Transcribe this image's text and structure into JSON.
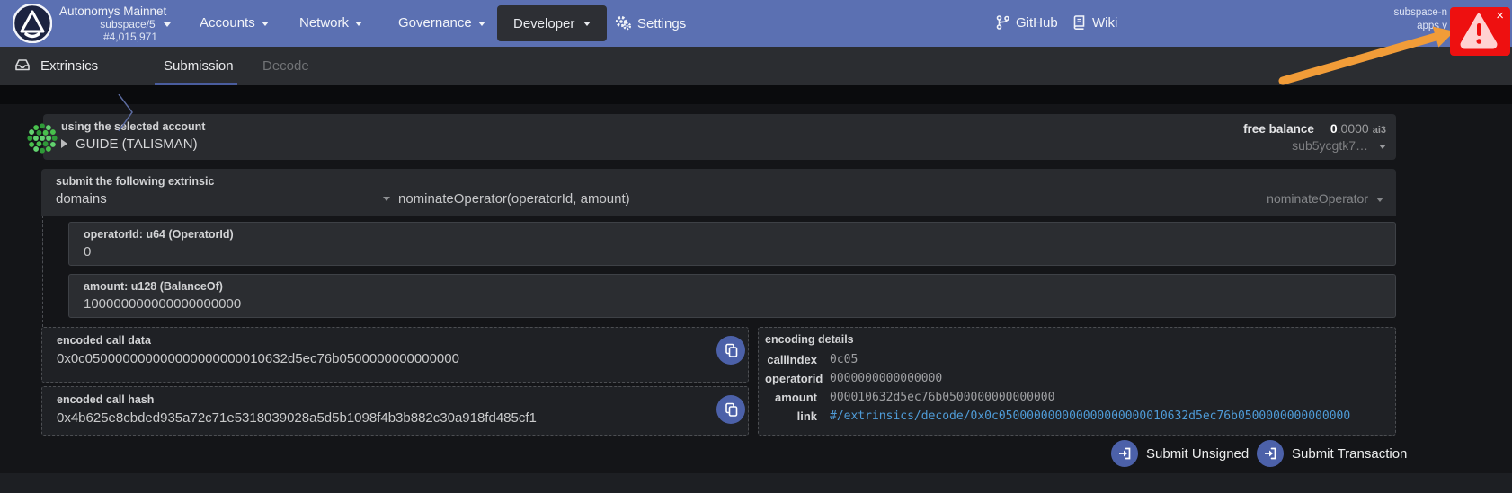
{
  "colors": {
    "nav_bg": "#5b70b2",
    "accent_blue": "#4c61a9",
    "link_blue": "#4f9cd8",
    "alert_red": "#ee1010",
    "arrow_orange": "#f19c38",
    "identicon_green": "#4ec24e",
    "tab_underline": "#4a5d9e"
  },
  "nav": {
    "chain": {
      "name": "Autonomys Mainnet",
      "runtime": "subspace/5",
      "block": "#4,015,971"
    },
    "items": [
      {
        "label": "Accounts"
      },
      {
        "label": "Network"
      },
      {
        "label": "Governance"
      },
      {
        "label": "Developer"
      },
      {
        "label": "Settings"
      }
    ],
    "links": [
      {
        "label": "GitHub"
      },
      {
        "label": "Wiki"
      }
    ],
    "corner_line1": "subspace-n",
    "corner_line2": "apps v",
    "alert_close": "×"
  },
  "tabbar": {
    "section": "Extrinsics",
    "tabs": [
      {
        "label": "Submission"
      },
      {
        "label": "Decode"
      }
    ]
  },
  "account": {
    "label": "using the selected account",
    "name": "GUIDE (TALISMAN)",
    "balance_label": "free balance",
    "balance_int": "0",
    "balance_frac": ".0000",
    "balance_unit": "ai3",
    "address": "sub5ycgtk7…"
  },
  "extrinsic": {
    "label": "submit the following extrinsic",
    "section": "domains",
    "signature": "nominateOperator(operatorId, amount)",
    "method": "nominateOperator"
  },
  "params": [
    {
      "label": "operatorId: u64 (OperatorId)",
      "value": "0"
    },
    {
      "label": "amount: u128 (BalanceOf)",
      "value": "100000000000000000000"
    }
  ],
  "output": {
    "call_data_label": "encoded call data",
    "call_data": "0x0c050000000000000000000010632d5ec76b0500000000000000",
    "call_hash_label": "encoded call hash",
    "call_hash": "0x4b625e8cbded935a72c71e5318039028a5d5b1098f4b3b882c30a918fd485cf1"
  },
  "encoding": {
    "title": "encoding details",
    "rows": [
      {
        "label": "callindex",
        "value": "0c05"
      },
      {
        "label": "operatorid",
        "value": "0000000000000000"
      },
      {
        "label": "amount",
        "value": "000010632d5ec76b0500000000000000"
      }
    ],
    "link_label": "link",
    "link_value": "#/extrinsics/decode/0x0c050000000000000000000010632d5ec76b0500000000000000"
  },
  "actions": [
    {
      "label": "Submit Unsigned"
    },
    {
      "label": "Submit Transaction"
    }
  ]
}
